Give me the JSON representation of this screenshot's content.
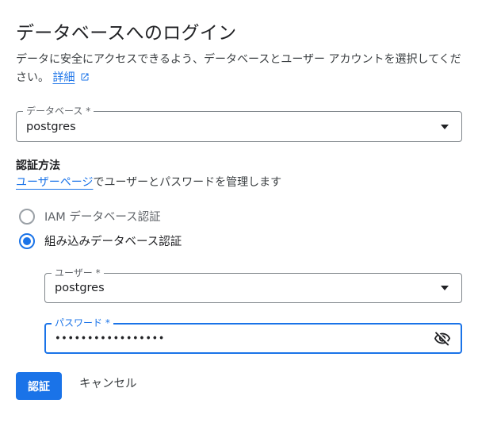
{
  "dialog": {
    "title": "データベースへのログイン",
    "description": "データに安全にアクセスできるよう、データベースとユーザー アカウントを選択してください。",
    "details_link": "詳細"
  },
  "database_field": {
    "label": "データベース *",
    "value": "postgres"
  },
  "auth": {
    "title": "認証方法",
    "link": "ユーザーページ",
    "desc_rest": "でユーザーとパスワードを管理します",
    "options": [
      {
        "label": "IAM データベース認証",
        "selected": false
      },
      {
        "label": "組み込みデータベース認証",
        "selected": true
      }
    ]
  },
  "user_field": {
    "label": "ユーザー *",
    "value": "postgres"
  },
  "password_field": {
    "label": "パスワード *",
    "value": "•••••••••••••••••"
  },
  "buttons": {
    "primary": "認証",
    "cancel": "キャンセル"
  },
  "colors": {
    "accent": "#1a73e8",
    "border": "#80868b"
  },
  "icons": {
    "details": "open-in-new-icon",
    "password_toggle": "visibility-off-icon",
    "dropdown": "arrow-drop-down-icon"
  }
}
